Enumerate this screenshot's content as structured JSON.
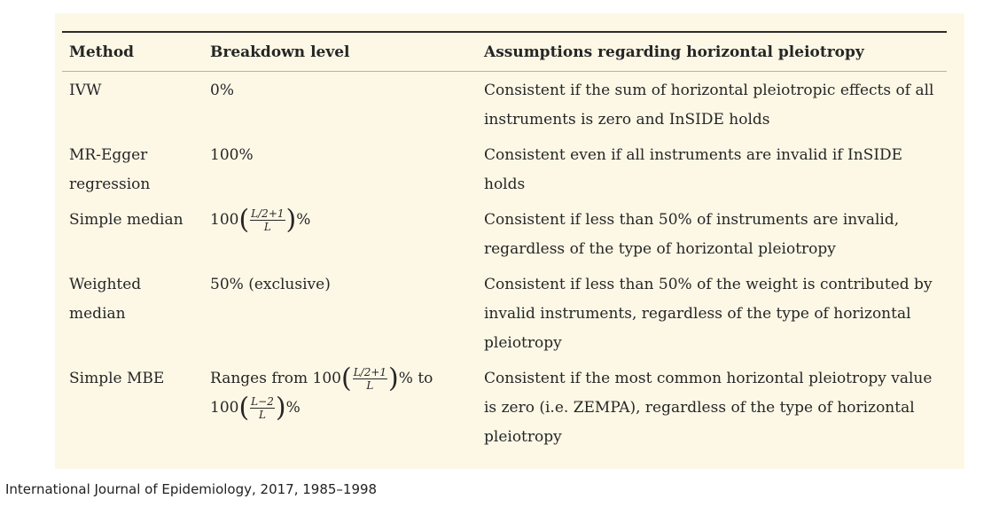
{
  "table": {
    "headers": [
      "Method",
      "Breakdown level",
      "Assumptions regarding horizontal pleiotropy"
    ],
    "rows": [
      {
        "method": "IVW",
        "breakdown": "0%",
        "assumption": "Consistent if the sum of horizontal pleiotropic effects of all instruments is zero and InSIDE holds"
      },
      {
        "method": "MR-Egger regression",
        "breakdown": "100%",
        "assumption": "Consistent even if all instruments are invalid if InSIDE holds"
      },
      {
        "method": "Simple median",
        "breakdown_prefix": "100",
        "breakdown_frac_num": "L/2+1",
        "breakdown_frac_den": "L",
        "breakdown_suffix": "%",
        "assumption": "Consistent if less than 50% of instruments are invalid, regardless of the type of horizontal pleiotropy"
      },
      {
        "method": "Weighted median",
        "breakdown": "50% (exclusive)",
        "assumption": "Consistent if less than 50% of the weight is contributed by invalid instruments, regardless of the type of horizontal pleiotropy"
      },
      {
        "method": "Simple MBE",
        "breakdown_prefix": "Ranges from 100",
        "breakdown_frac_num": "L/2+1",
        "breakdown_frac_den": "L",
        "breakdown_mid": "% to",
        "breakdown_prefix2": "100",
        "breakdown_frac2_num": "L−2",
        "breakdown_frac2_den": "L",
        "breakdown_suffix": "%",
        "assumption": "Consistent if the most common horizontal pleiotropy value is zero (i.e. ZEMPA), regardless of the type of horizontal pleiotropy"
      }
    ]
  },
  "caption": "International Journal of Epidemiology, 2017, 1985–1998"
}
